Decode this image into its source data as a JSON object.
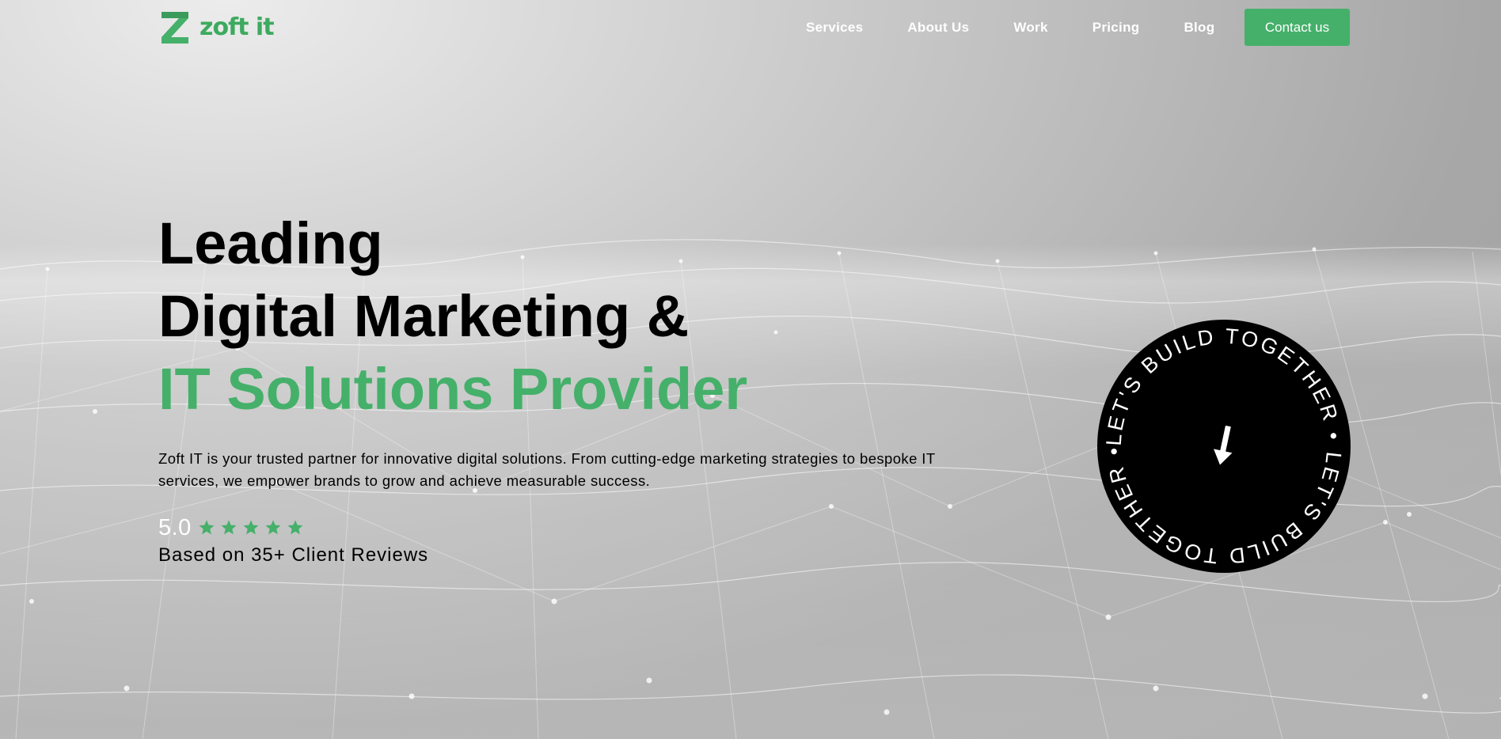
{
  "brand": {
    "name": "zoft it",
    "accent_color": "#45b06a",
    "logo_icon": "z-logo-icon"
  },
  "nav": {
    "items": [
      {
        "label": "Services"
      },
      {
        "label": "About Us"
      },
      {
        "label": "Work"
      },
      {
        "label": "Pricing"
      },
      {
        "label": "Blog"
      }
    ],
    "cta_label": "Contact us"
  },
  "hero": {
    "title_line1": "Leading",
    "title_line2": "Digital Marketing &",
    "title_line3": "IT Solutions Provider",
    "description": "Zoft IT is your trusted partner for innovative digital solutions. From cutting-edge marketing strategies to bespoke IT services, we empower brands to grow and achieve measurable success.",
    "rating_value": "5.0",
    "rating_stars": 5,
    "rating_max": 5,
    "reviews_text": "Based on 35+ Client Reviews"
  },
  "badge": {
    "circular_text": "LET'S BUILD TOGETHER • LET'S BUILD TOGETHER • ",
    "icon": "arrow-down-icon"
  }
}
